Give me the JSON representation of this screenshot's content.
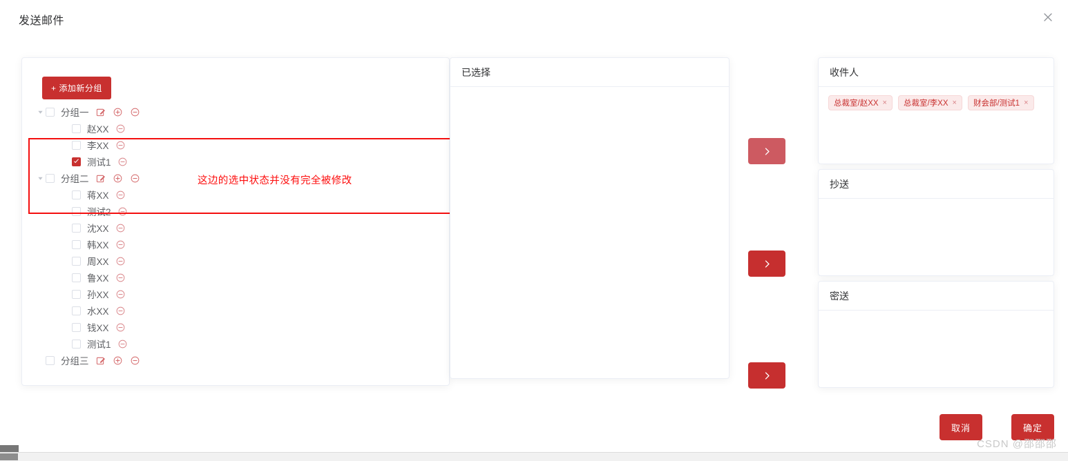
{
  "dialog": {
    "title": "发送邮件",
    "close_icon": "close-icon"
  },
  "tree_panel": {
    "add_group_label": "+ 添加新分组",
    "nodes": [
      {
        "type": "group",
        "label": "分组一",
        "expanded": true,
        "checked": false,
        "icons": [
          "edit-icon",
          "plus-circle-icon",
          "minus-circle-icon"
        ],
        "children": [
          {
            "label": "赵XX",
            "checked": false,
            "icon": "minus-circle-icon"
          },
          {
            "label": "李XX",
            "checked": false,
            "icon": "minus-circle-icon"
          },
          {
            "label": "测试1",
            "checked": true,
            "icon": "minus-circle-icon"
          }
        ]
      },
      {
        "type": "group",
        "label": "分组二",
        "expanded": true,
        "checked": false,
        "icons": [
          "edit-icon",
          "plus-circle-icon",
          "minus-circle-icon"
        ],
        "children": [
          {
            "label": "蒋XX",
            "checked": false,
            "icon": "minus-circle-icon"
          },
          {
            "label": "测试2",
            "checked": false,
            "icon": "minus-circle-icon"
          },
          {
            "label": "沈XX",
            "checked": false,
            "icon": "minus-circle-icon"
          },
          {
            "label": "韩XX",
            "checked": false,
            "icon": "minus-circle-icon"
          },
          {
            "label": "周XX",
            "checked": false,
            "icon": "minus-circle-icon"
          },
          {
            "label": "鲁XX",
            "checked": false,
            "icon": "minus-circle-icon"
          },
          {
            "label": "孙XX",
            "checked": false,
            "icon": "minus-circle-icon"
          },
          {
            "label": "水XX",
            "checked": false,
            "icon": "minus-circle-icon"
          },
          {
            "label": "钱XX",
            "checked": false,
            "icon": "minus-circle-icon"
          },
          {
            "label": "测试1",
            "checked": false,
            "icon": "minus-circle-icon"
          }
        ]
      },
      {
        "type": "group",
        "label": "分组三",
        "expanded": false,
        "checked": false,
        "icons": [
          "edit-icon",
          "plus-circle-icon",
          "minus-circle-icon"
        ],
        "children": []
      }
    ]
  },
  "annotation": {
    "text": "这边的选中状态并没有完全被修改",
    "color": "#fd0d0d"
  },
  "selected_panel": {
    "header": "已选择",
    "items": []
  },
  "transfer_buttons": [
    {
      "name": "transfer-to-recipient",
      "icon": "chevron-right-icon",
      "state": "hovered"
    },
    {
      "name": "transfer-to-cc",
      "icon": "chevron-right-icon",
      "state": "default"
    },
    {
      "name": "transfer-to-bcc",
      "icon": "chevron-right-icon",
      "state": "default"
    }
  ],
  "recipient_panel": {
    "header": "收件人",
    "tags": [
      {
        "label": "总裁室/赵XX",
        "close": "×"
      },
      {
        "label": "总裁室/李XX",
        "close": "×"
      },
      {
        "label": "财会部/测试1",
        "close": "×"
      }
    ]
  },
  "cc_panel": {
    "header": "抄送",
    "tags": []
  },
  "bcc_panel": {
    "header": "密送",
    "tags": []
  },
  "footer": {
    "cancel_label": "取消",
    "confirm_label": "确定"
  },
  "watermark": "CSDN @邵邵邵",
  "colors": {
    "brand_red": "#c8302f",
    "brand_red_hover": "#cd5a61",
    "tag_bg": "#fbeaea",
    "annotation_red": "#fd0d0d",
    "border": "#ebeef5"
  }
}
